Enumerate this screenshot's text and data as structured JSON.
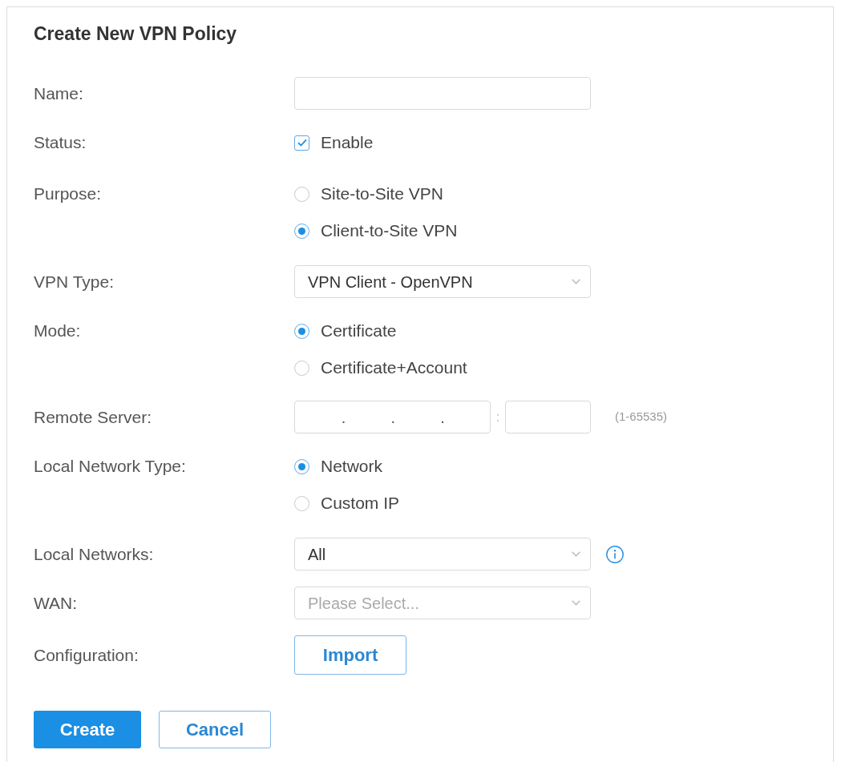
{
  "title": "Create New VPN Policy",
  "rows": [
    {
      "kind": "text_input",
      "label": "Name:"
    },
    {
      "kind": "checkbox",
      "label": "Status:",
      "option": {
        "label": "Enable",
        "checked": true
      }
    },
    {
      "kind": "radio",
      "label": "Purpose:",
      "options": [
        {
          "label": "Site-to-Site VPN",
          "selected": false
        },
        {
          "label": "Client-to-Site VPN",
          "selected": true
        }
      ]
    },
    {
      "kind": "select",
      "label": "VPN Type:",
      "value": "VPN Client - OpenVPN"
    },
    {
      "kind": "radio",
      "label": "Mode:",
      "options": [
        {
          "label": "Certificate",
          "selected": true
        },
        {
          "label": "Certificate+Account",
          "selected": false
        }
      ]
    },
    {
      "kind": "ip_port",
      "label": "Remote Server:",
      "ip_separator": ".",
      "port_separator": ":",
      "hint": "(1-65535)"
    },
    {
      "kind": "radio",
      "label": "Local Network Type:",
      "options": [
        {
          "label": "Network",
          "selected": true
        },
        {
          "label": "Custom IP",
          "selected": false
        }
      ]
    },
    {
      "kind": "select",
      "label": "Local Networks:",
      "value": "All",
      "info": true
    },
    {
      "kind": "select",
      "label": "WAN:",
      "placeholder": "Please Select..."
    },
    {
      "kind": "button",
      "label": "Configuration:",
      "button": "Import"
    }
  ],
  "actions": [
    {
      "label": "Create",
      "primary": true
    },
    {
      "label": "Cancel",
      "primary": false
    }
  ]
}
